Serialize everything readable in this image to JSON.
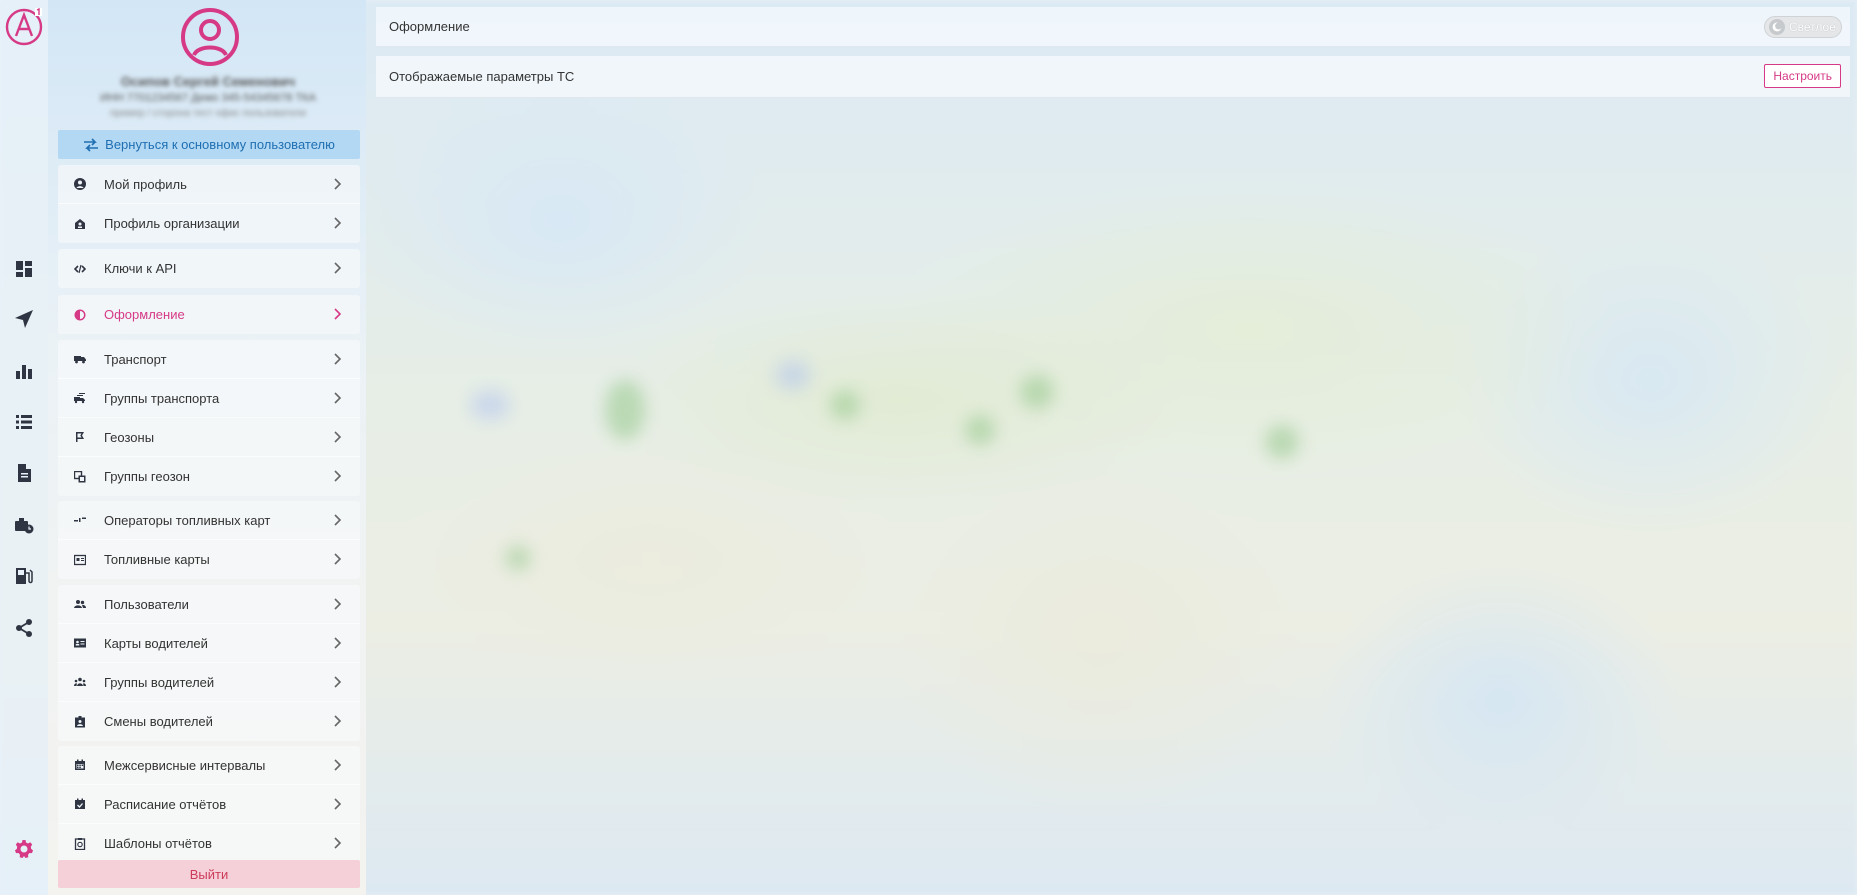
{
  "colors": {
    "accent": "#d63a86",
    "link": "#1f6fb2",
    "danger": "#cc3b5a"
  },
  "rail": {
    "logo_icon": "app-logo-icon",
    "items": [
      {
        "name": "dashboard-icon"
      },
      {
        "name": "navigation-arrow-icon"
      },
      {
        "name": "bar-chart-icon"
      },
      {
        "name": "list-icon"
      },
      {
        "name": "document-icon"
      },
      {
        "name": "briefcase-clock-icon"
      },
      {
        "name": "fuel-station-icon"
      },
      {
        "name": "share-icon"
      }
    ],
    "settings_icon": "gear-icon"
  },
  "profile": {
    "avatar_icon": "user-circle-icon",
    "name": "Осипов Сергей Семенович",
    "org": "ИНН 7701234567 Демо 345-54345678 ТКА",
    "sub": "пример / сторона тест офис пользователи"
  },
  "back_button": {
    "label": "Вернуться к основному пользователю",
    "icon": "swap-arrows-icon"
  },
  "menu": {
    "group1": [
      {
        "label": "Мой профиль",
        "icon": "user-circle-icon"
      },
      {
        "label": "Профиль организации",
        "icon": "building-user-icon"
      }
    ],
    "group2": [
      {
        "label": "Ключи к API",
        "icon": "code-icon"
      }
    ],
    "group3": [
      {
        "label": "Оформление",
        "icon": "half-circle-icon",
        "active": true
      }
    ],
    "group4": [
      {
        "label": "Транспорт",
        "icon": "truck-icon"
      },
      {
        "label": "Группы транспорта",
        "icon": "truck-group-icon"
      },
      {
        "label": "Геозоны",
        "icon": "geozone-icon"
      },
      {
        "label": "Группы геозон",
        "icon": "geozone-group-icon"
      }
    ],
    "group5": [
      {
        "label": "Операторы топливных карт",
        "icon": "fuel-operator-icon"
      },
      {
        "label": "Топливные карты",
        "icon": "fuel-card-icon"
      }
    ],
    "group6": [
      {
        "label": "Пользователи",
        "icon": "users-icon"
      },
      {
        "label": "Карты водителей",
        "icon": "driver-card-icon"
      },
      {
        "label": "Группы водителей",
        "icon": "driver-group-icon"
      },
      {
        "label": "Смены водителей",
        "icon": "driver-shift-icon"
      }
    ],
    "group7": [
      {
        "label": "Межсервисные интервалы",
        "icon": "calendar-icon"
      },
      {
        "label": "Расписание отчётов",
        "icon": "calendar-check-icon"
      },
      {
        "label": "Шаблоны отчётов",
        "icon": "report-template-icon"
      }
    ]
  },
  "logout": {
    "label": "Выйти"
  },
  "content": {
    "appearance": {
      "label": "Оформление",
      "toggle_text": "Светлое",
      "toggle_icon": "moon-icon"
    },
    "vehicle_params": {
      "label": "Отображаемые параметры ТС",
      "button": "Настроить"
    }
  }
}
